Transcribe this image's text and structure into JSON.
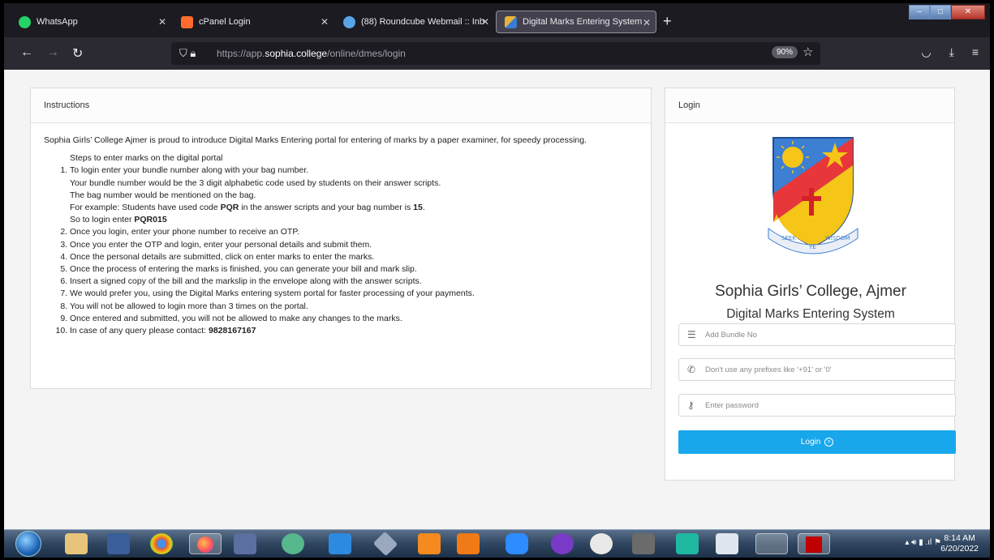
{
  "browser": {
    "tabs": [
      {
        "title": "WhatsApp",
        "favicon_color": "#25d366"
      },
      {
        "title": "cPanel Login",
        "favicon_color": "#ff6c2c"
      },
      {
        "title": "(88) Roundcube Webmail :: Inb",
        "favicon_color": "#59a5e8"
      },
      {
        "title": "Digital Marks Entering System",
        "favicon_color": "#e8b33a",
        "active": true
      }
    ],
    "url_prefix": "https://app.",
    "url_host": "sophia.college",
    "url_path": "/online/dmes/login",
    "zoom": "90%"
  },
  "instructions": {
    "header": "Instructions",
    "intro": "Sophia Girls’ College Ajmer is proud to introduce Digital Marks Entering portal for entering of marks by a paper examiner, for speedy processing.",
    "steps_heading": "Steps to enter marks on the digital portal",
    "step1": {
      "main": "To login enter your bundle number along with your bag number.",
      "line2": "Your bundle number would be the 3 digit alphabetic code used by students on their answer scripts.",
      "line3": "The bag number would be mentioned on the bag.",
      "ex_a": "For example: Students have used code ",
      "ex_code": "PQR",
      "ex_b": " in the answer scripts and your bag number is ",
      "ex_bag": "15",
      "ex_c": ".",
      "login_a": "So to login enter ",
      "login_code": "PQR015"
    },
    "steps": [
      "Once you login, enter your phone number to receive an OTP.",
      "Once you enter the OTP and login, enter your personal details and submit them.",
      "Once the personal details are submitted, click on enter marks to enter the marks.",
      "Once the process of entering the marks is finished, you can generate your bill and mark slip.",
      "Insert a signed copy of the bill and the markslip in the envelope along with the answer scripts.",
      "We would prefer you, using the Digital Marks entering system portal for faster processing of your payments.",
      "You will not be allowed to login more than 3 times on the portal.",
      "Once entered and submitted, you will not be allowed to make any changes to the marks."
    ],
    "step10_a": "In case of any query please contact: ",
    "step10_phone": "9828167167"
  },
  "login": {
    "header": "Login",
    "college_name": "Sophia Girls’ College, Ajmer",
    "system_name": "Digital Marks Entering System",
    "logo_motto": [
      "SEEK",
      "YE",
      "WISDOM"
    ],
    "bundle_placeholder": "Add Bundle No",
    "phone_placeholder": "Don't use any prefixes like '+91' or '0'",
    "password_placeholder": "Enter password",
    "button_label": "Login",
    "accent_color": "#19a7ec"
  },
  "taskbar": {
    "time": "8:14 AM",
    "date": "6/20/2022"
  }
}
